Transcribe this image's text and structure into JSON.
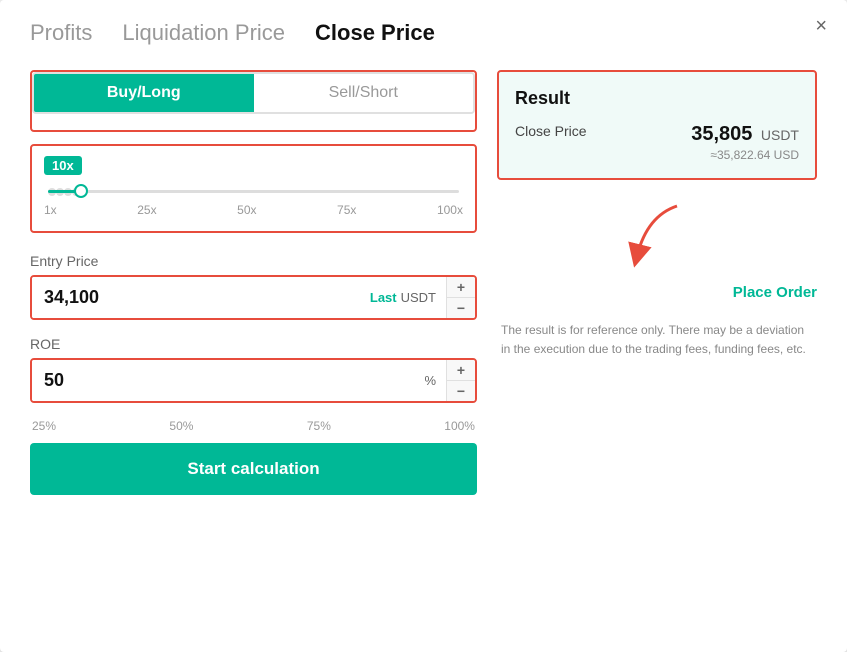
{
  "modal": {
    "close_label": "×"
  },
  "tabs": [
    {
      "id": "profits",
      "label": "Profits",
      "active": false
    },
    {
      "id": "liquidation",
      "label": "Liquidation Price",
      "active": false
    },
    {
      "id": "close-price",
      "label": "Close Price",
      "active": true
    }
  ],
  "left": {
    "direction": {
      "buy_label": "Buy/Long",
      "sell_label": "Sell/Short"
    },
    "leverage": {
      "badge": "10x",
      "marks": [
        "1x",
        "25x",
        "50x",
        "75x",
        "100x"
      ]
    },
    "entry_price": {
      "label": "Entry Price",
      "value": "34,100",
      "suffix_last": "Last",
      "suffix_unit": "USDT",
      "plus": "+",
      "minus": "−"
    },
    "roe": {
      "label": "ROE",
      "value": "50",
      "suffix": "%",
      "plus": "+",
      "minus": "−",
      "marks": [
        "25%",
        "50%",
        "75%",
        "100%"
      ]
    },
    "calc_btn": "Start calculation"
  },
  "right": {
    "result": {
      "title": "Result",
      "close_price_label": "Close Price",
      "close_price_value": "35,805",
      "close_price_unit": "USDT",
      "close_price_usd": "≈35,822.64 USD"
    },
    "place_order": "Place Order",
    "disclaimer": "The result is for reference only. There may be a deviation in the execution due to the trading fees, funding fees, etc."
  }
}
